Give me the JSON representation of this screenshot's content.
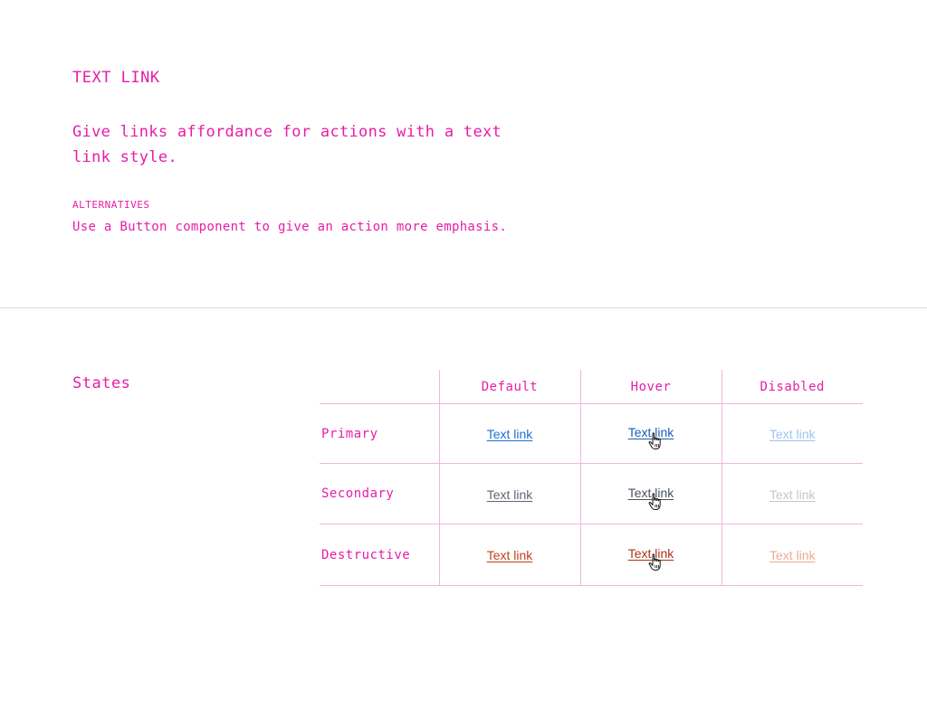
{
  "intro": {
    "title": "TEXT LINK",
    "lead": "Give links affordance for actions with a text link style.",
    "alternatives_heading": "ALTERNATIVES",
    "alternatives_text": "Use a Button component to give an action more emphasis."
  },
  "states": {
    "heading": "States",
    "columns": [
      "Default",
      "Hover",
      "Disabled"
    ],
    "rows": [
      {
        "label": "Primary",
        "cells": [
          "Text link",
          "Text link",
          "Text link"
        ]
      },
      {
        "label": "Secondary",
        "cells": [
          "Text link",
          "Text link",
          "Text link"
        ]
      },
      {
        "label": "Destructive",
        "cells": [
          "Text link",
          "Text link",
          "Text link"
        ]
      }
    ]
  },
  "colors": {
    "accent": "#e61ea8",
    "primary_default": "#1f6fd1",
    "primary_hover": "#1a5fb8",
    "primary_disabled": "#9cc4ee",
    "secondary_default": "#5f6773",
    "secondary_hover": "#4a525e",
    "secondary_disabled": "#c3c7cd",
    "destructive_default": "#c2401c",
    "destructive_hover": "#a8351a",
    "destructive_disabled": "#edaa94"
  },
  "icons": {
    "hover_cursor": "hand-pointer-icon"
  }
}
